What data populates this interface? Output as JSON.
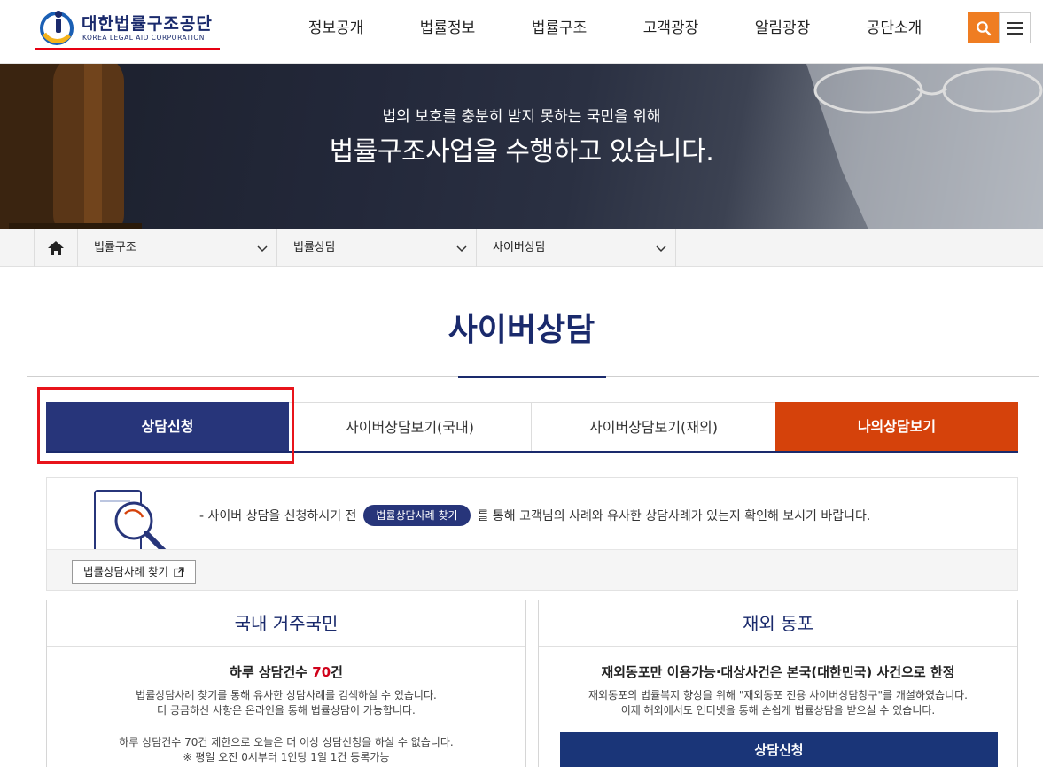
{
  "header": {
    "logo_kr": "대한법률구조공단",
    "logo_en": "KOREA LEGAL AID CORPORATION",
    "nav": [
      "정보공개",
      "법률정보",
      "법률구조",
      "고객광장",
      "알림광장",
      "공단소개"
    ],
    "accent_color": "#ef7d22",
    "icons": [
      "search-icon",
      "hamburger-menu-icon"
    ]
  },
  "hero": {
    "subtitle": "법의 보호를 충분히 받지 못하는 국민을 위해",
    "title": "법률구조사업을 수행하고 있습니다."
  },
  "breadcrumb": {
    "items": [
      "법률구조",
      "법률상담",
      "사이버상담"
    ]
  },
  "page": {
    "title": "사이버상담"
  },
  "tabs": [
    "상담신청",
    "사이버상담보기(국내)",
    "사이버상담보기(재외)",
    "나의상담보기"
  ],
  "notice": {
    "text_before": "- 사이버 상담을 신청하시기 전",
    "pill": "법률상담사례 찾기",
    "text_after": "를 통해 고객님의 사례와 유사한 상담사례가 있는지 확인해 보시기 바랍니다.",
    "button": "법률상담사례 찾기"
  },
  "domestic": {
    "heading": "국내 거주국민",
    "daily_prefix": "하루 상담건수 ",
    "daily_count": "70",
    "daily_suffix": "건",
    "line1": "법률상담사례 찾기를 통해 유사한 상담사례를 검색하실 수 있습니다.",
    "line2": "더 궁금하신 사항은 온라인을 통해 법률상담이 가능합니다.",
    "line3": "하루 상담건수 70건 제한으로 오늘은 더 이상 상담신청을 하실 수 없습니다.",
    "line4": "※ 평일 오전 0시부터 1인당 1일 1건 등록가능"
  },
  "overseas": {
    "heading": "재외 동포",
    "strong": "재외동포만 이용가능·대상사건은 본국(대한민국) 사건으로 한정",
    "line1": "재외동포의 법률복지 향상을 위해 \"재외동포 전용 사이버상담창구\"를 개설하였습니다.",
    "line2": "이제 해외에서도 인터넷을 통해 손쉽게 법률상담을 받으실 수 있습니다.",
    "button": "상담신청"
  }
}
